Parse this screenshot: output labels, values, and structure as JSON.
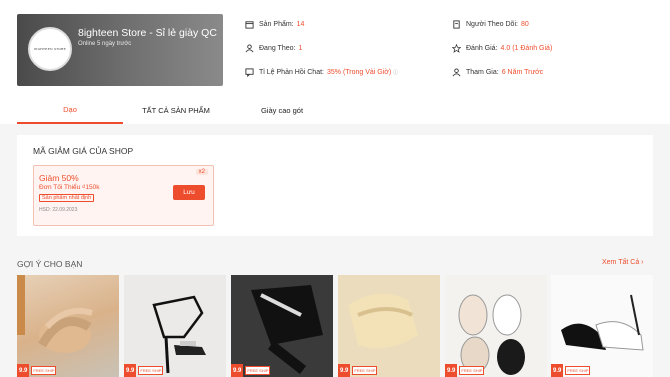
{
  "shop": {
    "name": "8ighteen Store - Sỉ lẻ giày QC",
    "online": "Online 5 ngày trước",
    "logo_text": "8IGHTEEN STORE"
  },
  "stats": [
    {
      "label": "Sản Phẩm:",
      "value": "14",
      "icon": "store-icon"
    },
    {
      "label": "Đang Theo:",
      "value": "1",
      "icon": "user-plus-icon"
    },
    {
      "label": "Tỉ Lệ Phản Hồi Chat:",
      "value": "35% (Trong Vài Giờ)",
      "icon": "chat-icon"
    },
    {
      "label": "Người Theo Dõi:",
      "value": "80",
      "icon": "followers-icon"
    },
    {
      "label": "Đánh Giá:",
      "value": "4.0 (1 Đánh Giá)",
      "icon": "star-icon"
    },
    {
      "label": "Tham Gia:",
      "value": "6 Năm Trước",
      "icon": "user-joined-icon"
    }
  ],
  "tabs": [
    "Dạo",
    "TẤT CẢ SẢN PHẨM",
    "Giày cao gót"
  ],
  "voucher_section": {
    "title": "MÃ GIẢM GIÁ CỦA SHOP",
    "voucher": {
      "discount": "Giảm 50%",
      "min_order": "Đơn Tối Thiểu ₫150k",
      "tag": "Sản phẩm nhất định",
      "expiry": "HSD: 22.09.2023",
      "count": "x2",
      "button": "Lưu"
    }
  },
  "recommend": {
    "title": "GỢI Ý CHO BẠN",
    "see_all": "Xem Tất Cả",
    "products": [
      {
        "price_badge": "9.9",
        "ship": "FREE SHIP"
      },
      {
        "price_badge": "9.9",
        "ship": "FREE SHIP"
      },
      {
        "price_badge": "9.9",
        "ship": "FREE SHIP"
      },
      {
        "price_badge": "9.9",
        "ship": "FREE SHIP"
      },
      {
        "price_badge": "9.9",
        "ship": "FREE SHIP"
      },
      {
        "price_badge": "9.9",
        "ship": "FREE SHIP"
      }
    ]
  },
  "colors": {
    "accent": "#ee4d2d"
  }
}
